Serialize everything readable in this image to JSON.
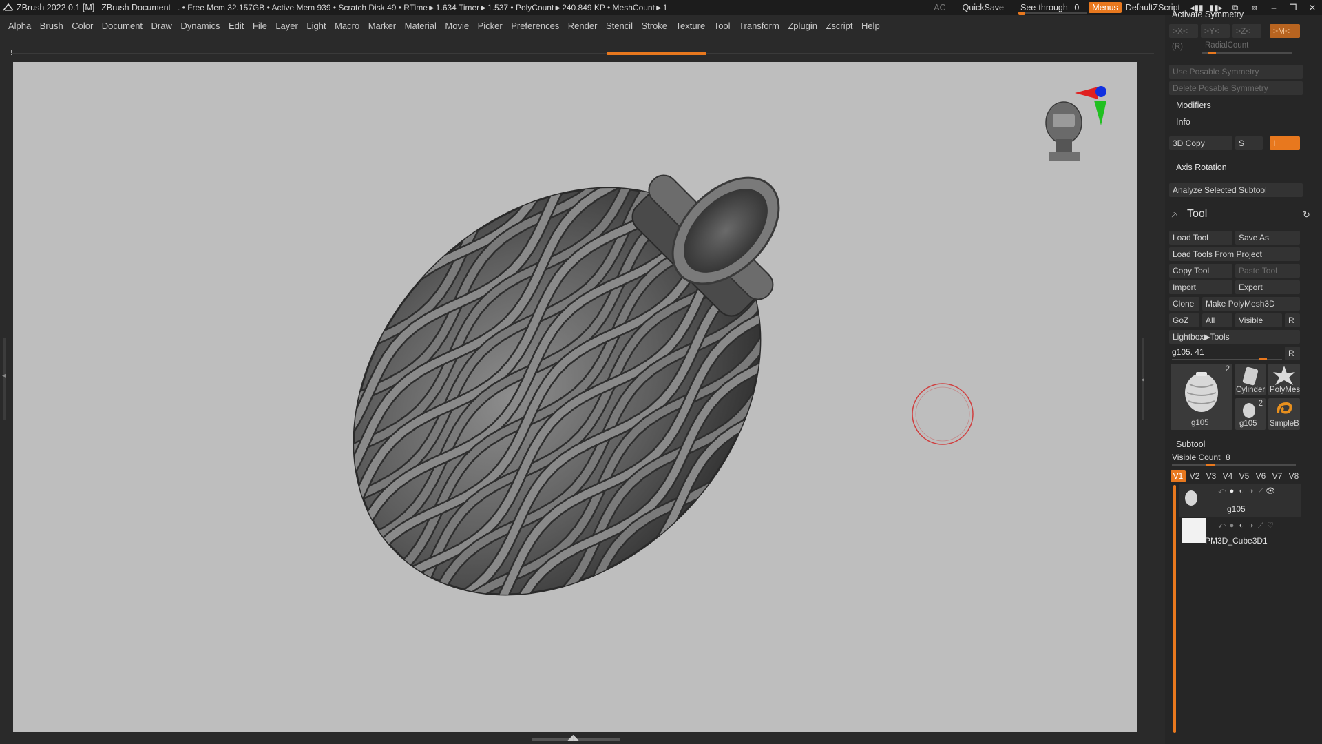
{
  "title_bar": {
    "app": "ZBrush 2022.0.1 [M]",
    "document": "ZBrush Document",
    "stats": ". • Free Mem 32.157GB • Active Mem 939 • Scratch Disk 49 • RTime►1.634 Timer►1.537 • PolyCount►240.849 KP • MeshCount►1",
    "ac": "AC",
    "quicksave": "QuickSave",
    "see_through_label": "See-through",
    "see_through_value": "0",
    "see_through_fraction": 0,
    "menus": "Menus",
    "zscript": "DefaultZScript"
  },
  "menu_bar": [
    "Alpha",
    "Brush",
    "Color",
    "Document",
    "Draw",
    "Dynamics",
    "Edit",
    "File",
    "Layer",
    "Light",
    "Macro",
    "Marker",
    "Material",
    "Movie",
    "Picker",
    "Preferences",
    "Render",
    "Stencil",
    "Stroke",
    "Texture",
    "Tool",
    "Transform",
    "Zplugin",
    "Zscript",
    "Help"
  ],
  "right_panel": {
    "activate_symmetry": "Activate Symmetry",
    "sym_x": ">X<",
    "sym_y": ">Y<",
    "sym_z": ">Z<",
    "sym_m": ">M<",
    "radial_r": "(R)",
    "radial_count": "RadialCount",
    "use_posable": "Use Posable Symmetry",
    "delete_posable": "Delete Posable Symmetry",
    "modifiers": "Modifiers",
    "info": "Info",
    "copy3d": "3D Copy",
    "copy_s": "S",
    "copy_value": "I",
    "axis_rotation": "Axis Rotation",
    "analyze": "Analyze Selected Subtool",
    "tool_title": "Tool",
    "load_tool": "Load Tool",
    "save_as": "Save As",
    "load_from_project": "Load Tools From Project",
    "copy_tool": "Copy Tool",
    "paste_tool": "Paste Tool",
    "import": "Import",
    "export": "Export",
    "clone": "Clone",
    "make_polymesh": "Make PolyMesh3D",
    "goz": "GoZ",
    "all": "All",
    "visible": "Visible",
    "r": "R",
    "lightbox_tools": "Lightbox▶Tools",
    "current_tool": "g105. 41",
    "current_tool_r": "R",
    "thumbs": {
      "main_label": "g105",
      "main_count": "2",
      "cylinder": "Cylinder",
      "polymesh": "PolyMes",
      "small_g105": "g105",
      "small_count": "2",
      "simpleb": "SimpleB"
    },
    "subtool_title": "Subtool",
    "visible_count_label": "Visible Count",
    "visible_count": "8",
    "visible_count_fraction": 0.3,
    "v_tabs": [
      "V1",
      "V2",
      "V3",
      "V4",
      "V5",
      "V6",
      "V7",
      "V8"
    ],
    "subtools": [
      "g105",
      "PM3D_Cube3D1"
    ]
  },
  "colors": {
    "accent": "#e8781e",
    "viewport_bg": "#bebebe",
    "panel_bg": "#262626",
    "gyro_red": "#e02020",
    "gyro_green": "#20c020",
    "gyro_blue": "#1030e0"
  }
}
